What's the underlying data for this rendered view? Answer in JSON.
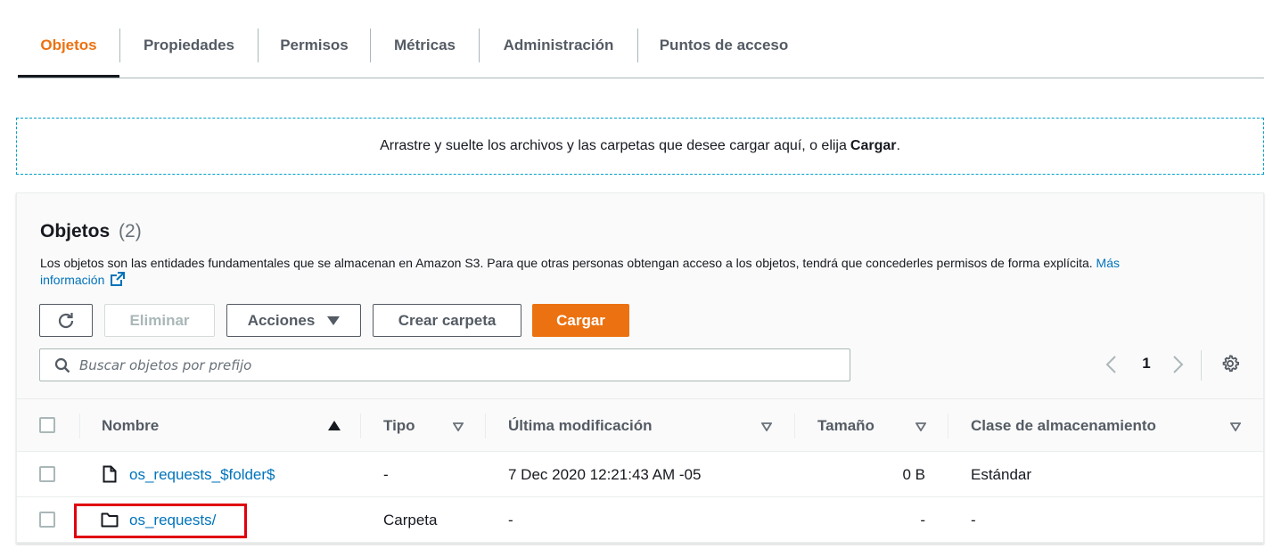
{
  "tabs": [
    {
      "label": "Objetos",
      "active": true
    },
    {
      "label": "Propiedades",
      "active": false
    },
    {
      "label": "Permisos",
      "active": false
    },
    {
      "label": "Métricas",
      "active": false
    },
    {
      "label": "Administración",
      "active": false
    },
    {
      "label": "Puntos de acceso",
      "active": false
    }
  ],
  "dropzone": {
    "text": "Arrastre y suelte los archivos y las carpetas que desee cargar aquí, o elija",
    "action": "Cargar",
    "end": "."
  },
  "objects": {
    "title": "Objetos",
    "count": "(2)",
    "description": "Los objetos son las entidades fundamentales que se almacenan en Amazon S3. Para que otras personas obtengan acceso a los objetos, tendrá que concederles permisos de forma explícita.",
    "more_info_line1": "Más",
    "more_info_line2": "información"
  },
  "toolbar": {
    "refresh_icon": "refresh-icon",
    "delete_label": "Eliminar",
    "actions_label": "Acciones",
    "create_folder_label": "Crear carpeta",
    "upload_label": "Cargar"
  },
  "search": {
    "placeholder": "Buscar objetos por prefijo",
    "value": ""
  },
  "pagination": {
    "current_page": "1"
  },
  "table": {
    "columns": {
      "name": "Nombre",
      "type": "Tipo",
      "modified": "Última modificación",
      "size": "Tamaño",
      "storage_class": "Clase de almacenamiento"
    },
    "rows": [
      {
        "icon": "file-icon",
        "name": "os_requests_$folder$",
        "type": "-",
        "modified": "7 Dec 2020 12:21:43 AM -05",
        "size": "0 B",
        "storage_class": "Estándar"
      },
      {
        "icon": "folder-icon",
        "name": "os_requests/",
        "type": "Carpeta",
        "modified": "-",
        "size": "-",
        "storage_class": "-"
      }
    ]
  },
  "colors": {
    "accent": "#ec7211",
    "link": "#0073bb",
    "highlight": "#e0000f"
  }
}
